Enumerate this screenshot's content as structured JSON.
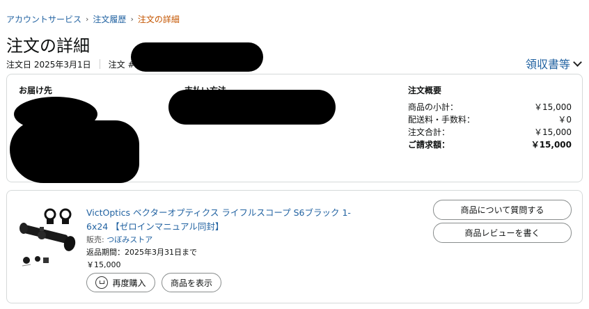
{
  "breadcrumb": {
    "items": [
      "アカウントサービス",
      "注文履歴"
    ],
    "current": "注文の詳細",
    "separator": "›"
  },
  "page_title": "注文の詳細",
  "meta": {
    "order_date": "注文日 2025年3月1日",
    "order_number_label": "注文 #"
  },
  "invoice_link": "領収書等",
  "summary": {
    "ship_to_heading": "お届け先",
    "payment_heading": "支払い方法",
    "order_summary_heading": "注文概要",
    "lines": [
      {
        "label": "商品の小計：",
        "value": "￥15,000"
      },
      {
        "label": "配送料・手数料：",
        "value": "￥0"
      },
      {
        "label": "注文合計：",
        "value": "￥15,000"
      }
    ],
    "total": {
      "label": "ご請求額：",
      "value": "￥15,000"
    }
  },
  "item": {
    "title": "VictOptics ベクターオプティクス ライフルスコープ S6ブラック 1-6x24 【ゼロインマニュアル同封】",
    "seller_label": "販売: ",
    "seller_name": "つぼみストア",
    "return_period": "返品期間：2025年3月31日まで",
    "price": "￥15,000",
    "rebuy_label": "再度購入",
    "view_label": "商品を表示",
    "ask_label": "商品について質問する",
    "review_label": "商品レビューを書く"
  },
  "colors": {
    "link": "#2162a1",
    "breadcrumb_current": "#c45500",
    "border": "#d5d9d9"
  }
}
